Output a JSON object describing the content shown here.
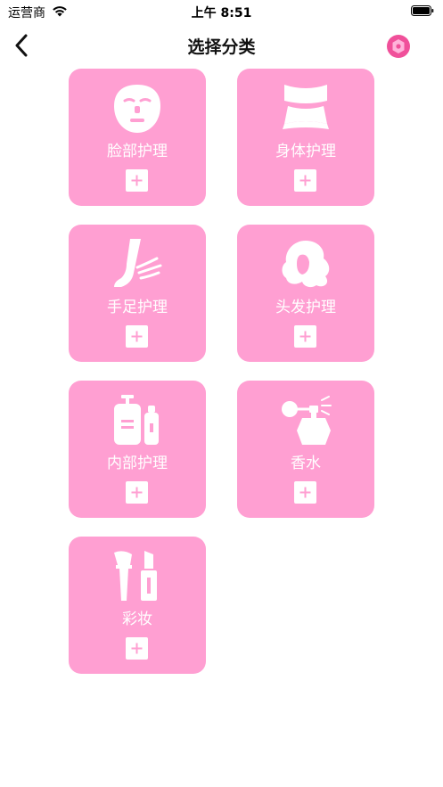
{
  "status_bar": {
    "carrier": "运营商",
    "time": "上午 8:51",
    "icons": [
      "wifi-icon",
      "battery-icon"
    ]
  },
  "nav": {
    "title": "选择分类",
    "back_icon": "chevron-left-icon",
    "right_icon": "hexagon-badge-icon"
  },
  "colors": {
    "tile_bg": "#ff9fd2",
    "tile_text": "#ffffff",
    "badge": "#f0509a"
  },
  "categories": [
    {
      "label": "脸部护理",
      "icon": "face-mask-icon"
    },
    {
      "label": "身体护理",
      "icon": "body-icon"
    },
    {
      "label": "手足护理",
      "icon": "hand-foot-icon"
    },
    {
      "label": "头发护理",
      "icon": "hair-icon"
    },
    {
      "label": "内部护理",
      "icon": "bottles-icon"
    },
    {
      "label": "香水",
      "icon": "perfume-icon"
    },
    {
      "label": "彩妆",
      "icon": "makeup-icon"
    }
  ]
}
